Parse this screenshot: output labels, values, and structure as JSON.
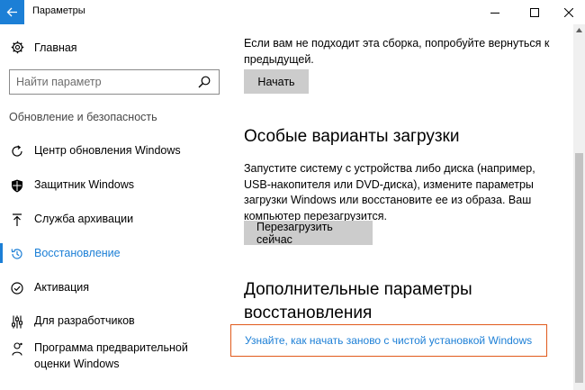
{
  "window": {
    "title": "Параметры",
    "accent": "#1c7fd6"
  },
  "sidebar": {
    "home_label": "Главная",
    "search_placeholder": "Найти параметр",
    "section_title": "Обновление и безопасность",
    "items": [
      {
        "label": "Центр обновления Windows",
        "icon": "refresh-icon",
        "active": false
      },
      {
        "label": "Защитник Windows",
        "icon": "shield-icon",
        "active": false
      },
      {
        "label": "Служба архивации",
        "icon": "upload-arrow-icon",
        "active": false
      },
      {
        "label": "Восстановление",
        "icon": "history-icon",
        "active": true
      },
      {
        "label": "Активация",
        "icon": "check-circle-icon",
        "active": false
      },
      {
        "label": "Для разработчиков",
        "icon": "developer-sliders-icon",
        "active": false
      },
      {
        "label": "Программа предварительной оценки Windows",
        "icon": "insider-icon",
        "active": false
      }
    ]
  },
  "main": {
    "rollback_text": "Если вам не подходит эта сборка, попробуйте вернуться к предыдущей.",
    "start_button": "Начать",
    "special_boot_heading": "Особые варианты загрузки",
    "special_boot_text": "Запустите систему с устройства либо диска (например, USB-накопителя или DVD-диска), измените параметры загрузки Windows или восстановите ее из образа. Ваш компьютер перезагрузится.",
    "restart_button": "Перезагрузить сейчас",
    "more_options_heading": "Дополнительные параметры восстановления",
    "clean_install_link": "Узнайте, как начать заново с чистой установкой Windows",
    "highlight_color": "#e05a1c"
  }
}
